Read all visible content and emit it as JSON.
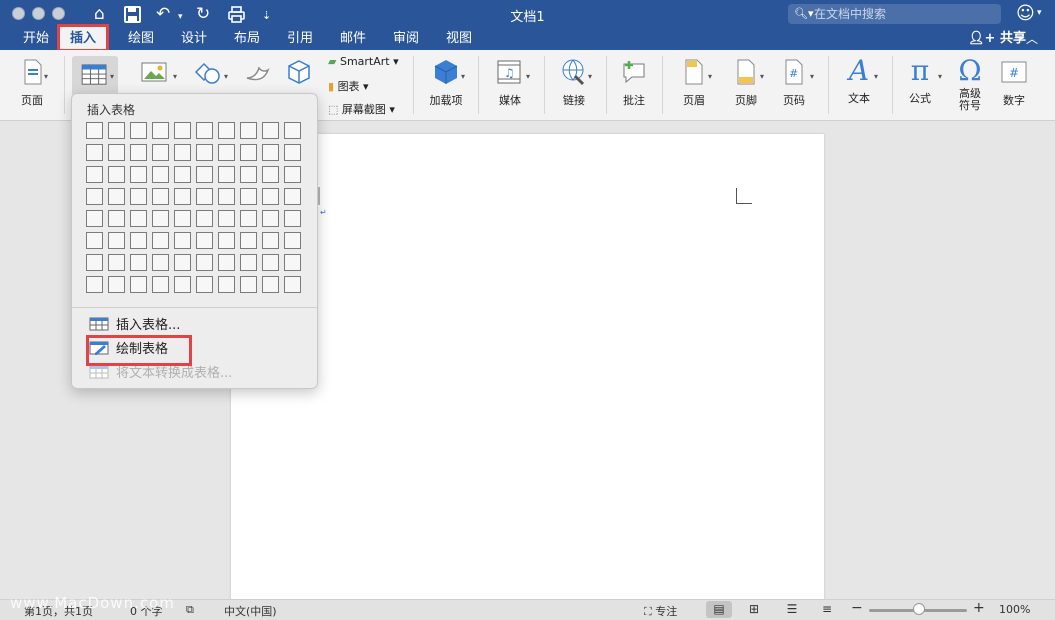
{
  "window": {
    "title": "文档1"
  },
  "search": {
    "placeholder": "在文档中搜索"
  },
  "tabs": [
    {
      "label": "开始"
    },
    {
      "label": "插入"
    },
    {
      "label": "绘图"
    },
    {
      "label": "设计"
    },
    {
      "label": "布局"
    },
    {
      "label": "引用"
    },
    {
      "label": "邮件"
    },
    {
      "label": "审阅"
    },
    {
      "label": "视图"
    }
  ],
  "share": {
    "label": "共享"
  },
  "ribbon": {
    "page": "页面",
    "smartart": "SmartArt",
    "chart": "图表",
    "screenshot": "屏幕截图",
    "addins": "加载项",
    "media": "媒体",
    "link": "链接",
    "comment": "批注",
    "header": "页眉",
    "footer": "页脚",
    "page_number": "页码",
    "text": "文本",
    "equation": "公式",
    "symbol": "高级\n符号",
    "number": "数字"
  },
  "table_popup": {
    "title": "插入表格",
    "grid_rows": 8,
    "grid_cols": 10,
    "insert_table": "插入表格...",
    "draw_table": "绘制表格",
    "convert_text": "将文本转换成表格..."
  },
  "status": {
    "page": "第1页，共1页",
    "words": "0 个字",
    "language": "中文(中国)",
    "focus": "专注",
    "zoom": "100%"
  },
  "watermark": "www.MacDown.com",
  "colors": {
    "accent": "#2a5699",
    "highlight": "#e0434a"
  }
}
